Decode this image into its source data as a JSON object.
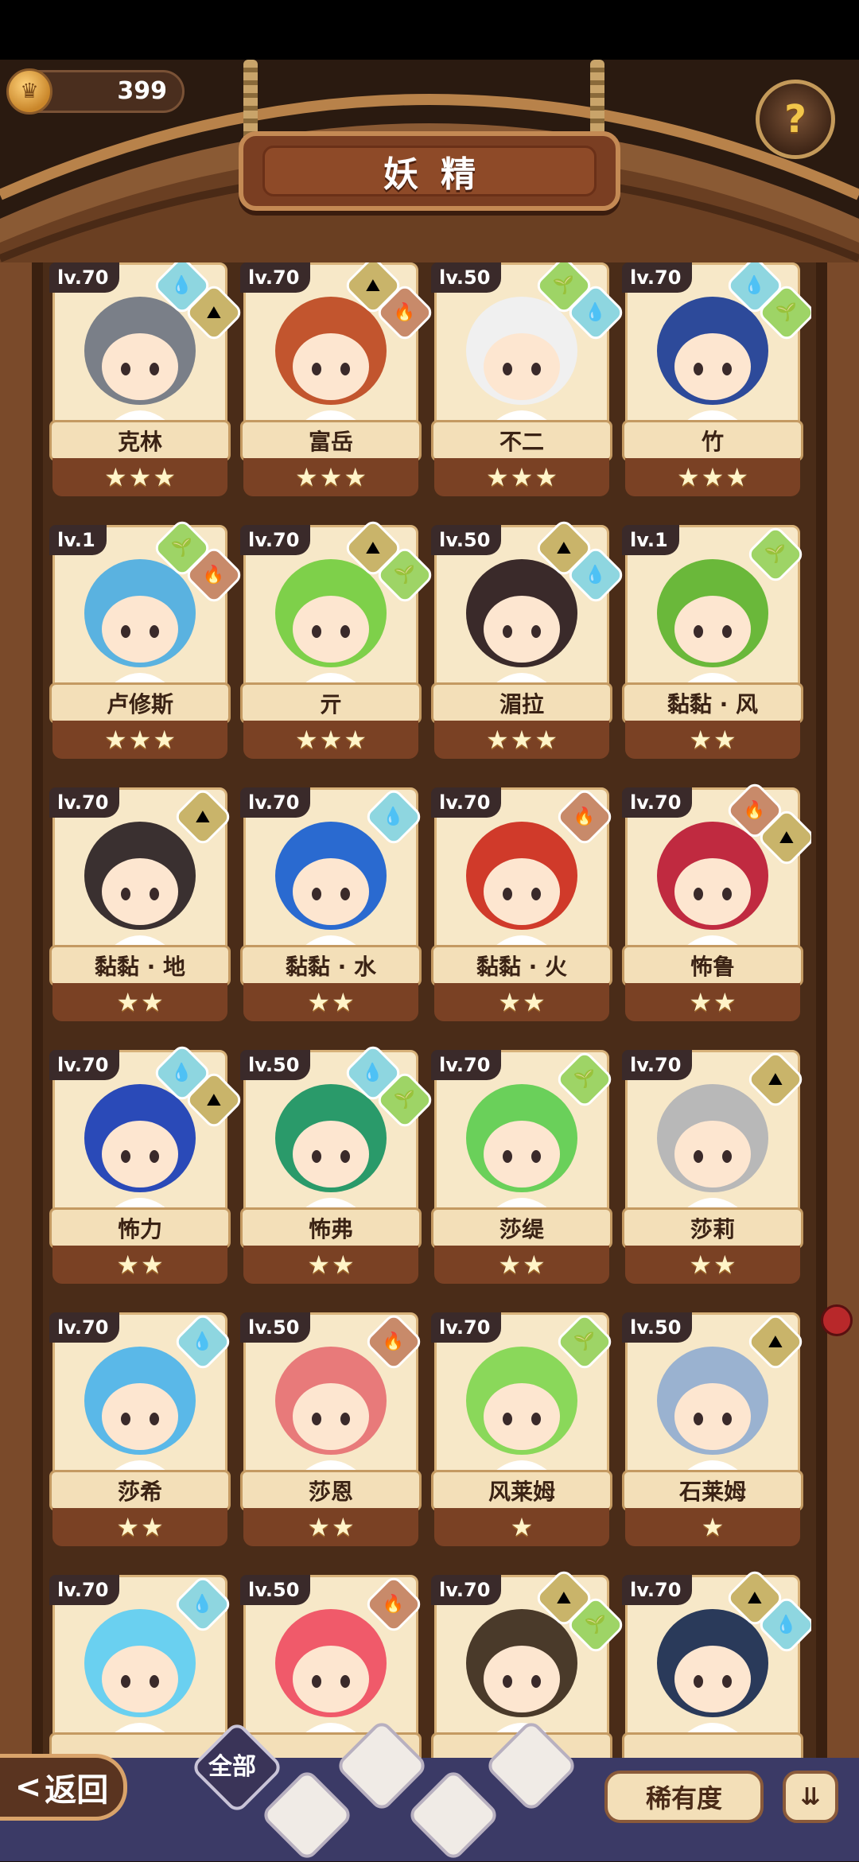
{
  "currency": {
    "value": "399",
    "icon": "crown-coin-icon"
  },
  "help": {
    "label": "?",
    "icon": "sprout-help-icon"
  },
  "header": {
    "title": "妖精"
  },
  "elements_legend": {
    "water": "#8ed6e0",
    "earth": "#c9b46a",
    "wood": "#9ed466",
    "fire": "#c88a6a"
  },
  "fairies": [
    {
      "name": "克林",
      "level": "lv.70",
      "stars": 3,
      "elements": [
        "water",
        "earth"
      ],
      "color": "#7a7f88"
    },
    {
      "name": "富岳",
      "level": "lv.70",
      "stars": 3,
      "elements": [
        "earth",
        "fire"
      ],
      "color": "#c2552e"
    },
    {
      "name": "不二",
      "level": "lv.50",
      "stars": 3,
      "elements": [
        "wood",
        "water"
      ],
      "color": "#f0f0f0"
    },
    {
      "name": "竹",
      "level": "lv.70",
      "stars": 3,
      "elements": [
        "water",
        "wood"
      ],
      "color": "#2d4a9a"
    },
    {
      "name": "卢修斯",
      "level": "lv.1",
      "stars": 3,
      "elements": [
        "wood",
        "fire"
      ],
      "color": "#5ab2e0"
    },
    {
      "name": "亓",
      "level": "lv.70",
      "stars": 3,
      "elements": [
        "earth",
        "wood"
      ],
      "color": "#7ed04a"
    },
    {
      "name": "湄拉",
      "level": "lv.50",
      "stars": 3,
      "elements": [
        "earth",
        "water"
      ],
      "color": "#3a2a2a"
    },
    {
      "name": "黏黏 · 风",
      "level": "lv.1",
      "stars": 2,
      "elements": [
        "wood"
      ],
      "color": "#6ab83a"
    },
    {
      "name": "黏黏 · 地",
      "level": "lv.70",
      "stars": 2,
      "elements": [
        "earth"
      ],
      "color": "#3a3030"
    },
    {
      "name": "黏黏 · 水",
      "level": "lv.70",
      "stars": 2,
      "elements": [
        "water"
      ],
      "color": "#2a6ad0"
    },
    {
      "name": "黏黏 · 火",
      "level": "lv.70",
      "stars": 2,
      "elements": [
        "fire"
      ],
      "color": "#d03a2a"
    },
    {
      "name": "怖鲁",
      "level": "lv.70",
      "stars": 2,
      "elements": [
        "fire",
        "earth"
      ],
      "color": "#c02a40"
    },
    {
      "name": "怖力",
      "level": "lv.70",
      "stars": 2,
      "elements": [
        "water",
        "earth"
      ],
      "color": "#2a4ab8"
    },
    {
      "name": "怖弗",
      "level": "lv.50",
      "stars": 2,
      "elements": [
        "water",
        "wood"
      ],
      "color": "#2a9a6a"
    },
    {
      "name": "莎缇",
      "level": "lv.70",
      "stars": 2,
      "elements": [
        "wood"
      ],
      "color": "#6ad05a"
    },
    {
      "name": "莎莉",
      "level": "lv.70",
      "stars": 2,
      "elements": [
        "earth"
      ],
      "color": "#b8b8b8"
    },
    {
      "name": "莎希",
      "level": "lv.70",
      "stars": 2,
      "elements": [
        "water"
      ],
      "color": "#5ab8e8"
    },
    {
      "name": "莎恩",
      "level": "lv.50",
      "stars": 2,
      "elements": [
        "fire"
      ],
      "color": "#e87a7a"
    },
    {
      "name": "风莱姆",
      "level": "lv.70",
      "stars": 1,
      "elements": [
        "wood"
      ],
      "color": "#8ad85a"
    },
    {
      "name": "石莱姆",
      "level": "lv.50",
      "stars": 1,
      "elements": [
        "earth"
      ],
      "color": "#9ab2d0"
    },
    {
      "name": "",
      "level": "lv.70",
      "stars": 0,
      "elements": [
        "water"
      ],
      "color": "#6ad0f0"
    },
    {
      "name": "",
      "level": "lv.50",
      "stars": 0,
      "elements": [
        "fire"
      ],
      "color": "#f05a6a"
    },
    {
      "name": "",
      "level": "lv.70",
      "stars": 0,
      "elements": [
        "earth",
        "wood"
      ],
      "color": "#4a3a2a"
    },
    {
      "name": "",
      "level": "lv.70",
      "stars": 0,
      "elements": [
        "earth",
        "water"
      ],
      "color": "#2a3a5a"
    }
  ],
  "bottom": {
    "back_label": "返回",
    "back_icon": "chevron-left-icon",
    "filter_all_label": "全部",
    "filters": [
      "water-element-icon",
      "wood-element-icon",
      "earth-element-icon",
      "fire-element-icon"
    ],
    "rarity_label": "稀有度",
    "sort_icon": "sort-descending-icon"
  }
}
